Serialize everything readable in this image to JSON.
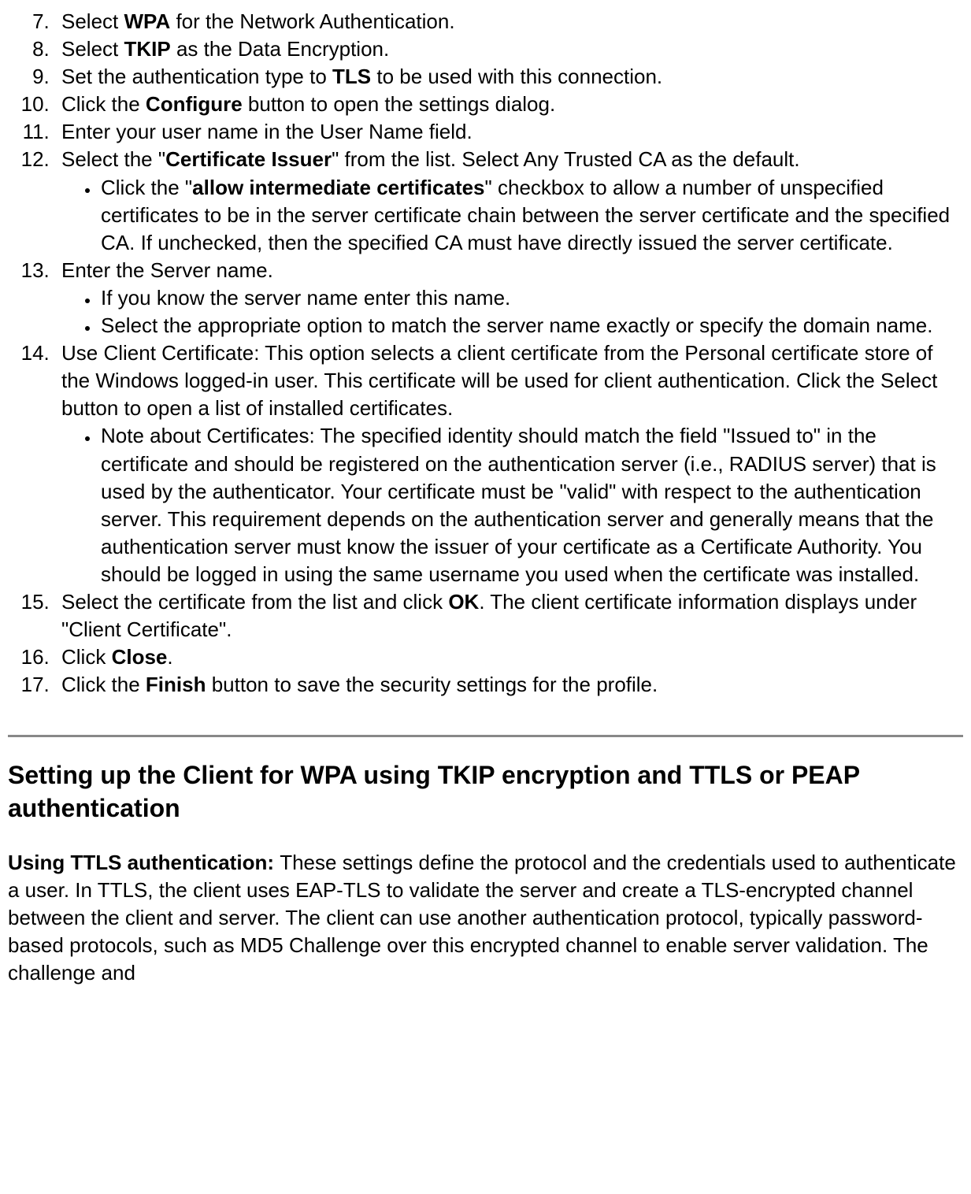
{
  "list": {
    "item7": {
      "pre": "Select ",
      "bold": "WPA",
      "post": " for the Network Authentication."
    },
    "item8": {
      "pre": "Select ",
      "bold": "TKIP",
      "post": " as the Data Encryption."
    },
    "item9": {
      "pre": "Set the authentication type to ",
      "bold": "TLS",
      "post": " to be used with this connection."
    },
    "item10": {
      "pre": "Click the ",
      "bold": "Configure",
      "post": " button to open the settings dialog."
    },
    "item11": "Enter your user name in the User Name field.",
    "item12": {
      "pre": "Select the \"",
      "bold": "Certificate Issuer",
      "post": "\" from the list. Select Any Trusted CA as the default."
    },
    "item12sub1": {
      "pre": "Click the \"",
      "bold": "allow intermediate certificates",
      "post": "\" checkbox to allow a number of unspecified certificates to be in the server certificate chain between the server certificate and the specified CA. If unchecked, then the specified CA must have directly issued the server certificate."
    },
    "item13": "Enter the Server name.",
    "item13sub1": "If you know the server name enter this name.",
    "item13sub2": "Select the appropriate option to match the server name exactly or specify the domain name.",
    "item14": "Use Client Certificate: This option selects a client certificate from the Personal certificate store of the Windows logged-in user. This certificate will be used for client authentication. Click the Select button to open a list of installed certificates.",
    "item14sub1": "Note about Certificates: The specified identity should match the field \"Issued to\" in the certificate and should be registered on the authentication server (i.e., RADIUS server) that is used by the authenticator. Your certificate must be \"valid\" with respect to the authentication server. This requirement depends on the authentication server and generally means that the authentication server must know the issuer of your certificate as a Certificate Authority. You should be logged in using the same username you used when the certificate was installed.",
    "item15": {
      "pre": "Select the certificate from the list and click ",
      "bold": "OK",
      "post": ". The client certificate information displays under \"Client Certificate\"."
    },
    "item16": {
      "pre": "Click ",
      "bold": "Close",
      "post": "."
    },
    "item17": {
      "pre": "Click the ",
      "bold": "Finish",
      "post": " button to save the security settings for the profile."
    }
  },
  "heading": "Setting up the Client for WPA using TKIP encryption and TTLS or PEAP authentication",
  "paragraph": {
    "bold": "Using TTLS authentication: ",
    "text": "These settings define the protocol and the credentials used to authenticate a user. In TTLS, the client uses EAP-TLS to validate the server and create a TLS-encrypted channel between the client and server. The client can use another authentication protocol, typically password-based protocols, such as MD5 Challenge over this encrypted channel to enable server validation. The challenge and"
  }
}
